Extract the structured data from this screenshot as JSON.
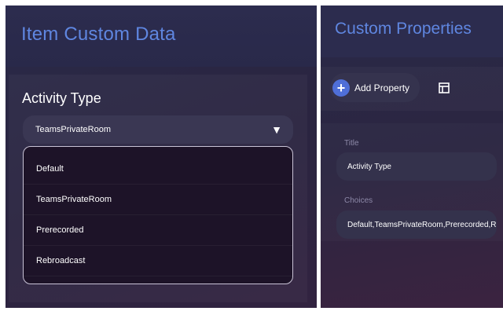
{
  "left": {
    "title": "Item Custom Data",
    "section_label": "Activity Type",
    "selected": "TeamsPrivateRoom",
    "caret": "▼",
    "options": [
      "Default",
      "TeamsPrivateRoom",
      "Prerecorded",
      "Rebroadcast"
    ]
  },
  "right": {
    "title": "Custom Properties",
    "add_button_label": "Add Property",
    "add_icon": "+",
    "layout_icon": "layout-icon",
    "fields": [
      {
        "label": "Title",
        "value": "Activity Type"
      },
      {
        "label": "Choices",
        "value": "Default,TeamsPrivateRoom,Prerecorded,Rebroadcast"
      }
    ]
  },
  "colors": {
    "accent": "#5f86e0",
    "button_blue": "#4f6fd8",
    "panel_bg": "#2a2a48"
  }
}
